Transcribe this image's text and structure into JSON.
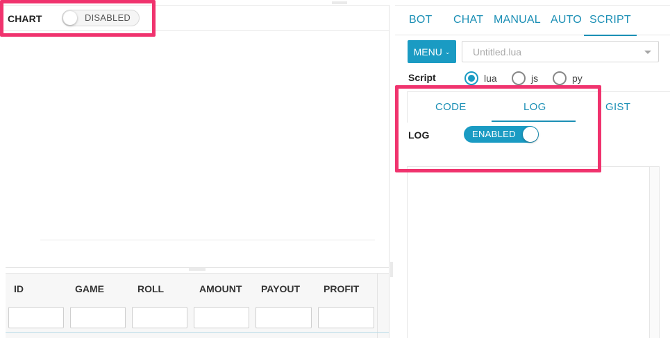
{
  "chart_toolbar": {
    "label": "CHART",
    "toggle_text": "DISABLED"
  },
  "bets_table": {
    "columns": [
      "ID",
      "GAME",
      "ROLL",
      "AMOUNT",
      "PAYOUT",
      "PROFIT"
    ]
  },
  "main_tabs": [
    {
      "label": "BOT"
    },
    {
      "label": "CHAT"
    },
    {
      "label": "MANUAL"
    },
    {
      "label": "AUTO"
    },
    {
      "label": "SCRIPT",
      "active": true
    }
  ],
  "script_panel": {
    "menu_label": "MENU",
    "file_name": "Untitled.lua",
    "script_label": "Script",
    "languages": [
      {
        "label": "lua",
        "checked": true
      },
      {
        "label": "js",
        "checked": false
      },
      {
        "label": "py",
        "checked": false
      }
    ],
    "sub_tabs": [
      {
        "label": "CODE"
      },
      {
        "label": "LOG",
        "active": true
      },
      {
        "label": "GIST"
      }
    ],
    "log_label": "LOG",
    "log_toggle_text": "ENABLED"
  },
  "colors": {
    "accent": "#1a9bc3",
    "highlight": "#f0336e"
  }
}
